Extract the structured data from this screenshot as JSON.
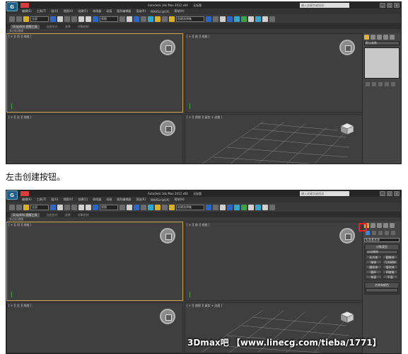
{
  "window": {
    "app_button": "G",
    "title_app": "Autodesk 3ds Max  2012 x64",
    "title_doc": "无标题",
    "search_placeholder": "键入关键字或短语",
    "min": "_",
    "max": "□",
    "close": "×"
  },
  "menu": [
    "编辑(E)",
    "工具(T)",
    "组(G)",
    "视图(V)",
    "创建(C)",
    "修改器",
    "动画",
    "图形编辑器",
    "渲染(R)",
    "MAXScript(X)",
    "帮助(H)"
  ],
  "toolbar": {
    "filter": "全部",
    "view": "视图",
    "selection_set": "创建选择集"
  },
  "graphite_tabs": [
    "Graphite 建模工具",
    "自由形式",
    "选择",
    "对象绘制"
  ],
  "ribbon_label": "多边形建模",
  "viewports": {
    "top": "[ + ][ 顶 ][ 线框 ]",
    "front": "[ + ][ 前 ][ 线框 ]",
    "left": "[ + ][ 左 ][ 线框 ]",
    "perspective": "[ + ][ 透视 ][ 真实 + 边面 ]"
  },
  "panel1": {
    "name_field": "默认参数"
  },
  "panel2": {
    "category": "标准基本体",
    "rollout1_title": "对象类型",
    "autogrid": "自动栅格",
    "buttons": [
      "长方体",
      "圆锥体",
      "球体",
      "几何球体",
      "圆柱体",
      "管状体",
      "圆环",
      "四棱锥",
      "茶壶",
      "平面"
    ],
    "rollout2_title": "名称和颜色"
  },
  "caption": "左击创建按钮。",
  "watermark": "3Dmax吧 【www.linecg.com/tieba/1771】",
  "colors": {
    "active_border": "#c9a54c",
    "highlight": "#e22222",
    "accent": "#e0b13f"
  }
}
